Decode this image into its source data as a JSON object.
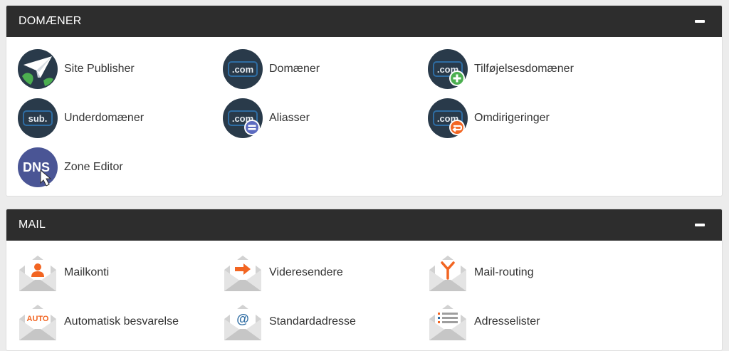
{
  "sections": {
    "domains": {
      "title": "DOMÆNER",
      "items": [
        {
          "label": "Site Publisher",
          "icon": "site-publisher-icon"
        },
        {
          "label": "Domæner",
          "icon": "domains-icon",
          "badge": ".com"
        },
        {
          "label": "Tilføjelsesdomæner",
          "icon": "addon-domains-icon",
          "badge": ".com"
        },
        {
          "label": "Underdomæner",
          "icon": "subdomains-icon",
          "badge": "sub."
        },
        {
          "label": "Aliasser",
          "icon": "aliases-icon",
          "badge": ".com"
        },
        {
          "label": "Omdirigeringer",
          "icon": "redirects-icon",
          "badge": ".com"
        },
        {
          "label": "Zone Editor",
          "icon": "zone-editor-icon",
          "badge": "DNS"
        }
      ]
    },
    "mail": {
      "title": "MAIL",
      "items": [
        {
          "label": "Mailkonti",
          "icon": "email-accounts-icon"
        },
        {
          "label": "Videresendere",
          "icon": "forwarders-icon"
        },
        {
          "label": "Mail-routing",
          "icon": "email-routing-icon"
        },
        {
          "label": "Automatisk besvarelse",
          "icon": "autoresponders-icon",
          "badge": "AUTO"
        },
        {
          "label": "Standardadresse",
          "icon": "default-address-icon",
          "badge": "@"
        },
        {
          "label": "Adresselister",
          "icon": "mailing-lists-icon"
        }
      ]
    }
  },
  "colors": {
    "header_bg": "#2d2d2d",
    "icon_navy": "#293a4a",
    "badge_blue": "#2f6da3",
    "accent_green": "#4caf50",
    "accent_purple": "#5c6bc0",
    "accent_orange": "#f26522"
  }
}
